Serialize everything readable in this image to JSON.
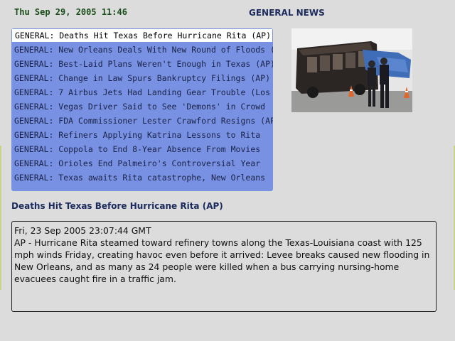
{
  "header": {
    "clock": "Thu Sep 29, 2005 11:46",
    "section_title": "GENERAL NEWS"
  },
  "headlines": {
    "selected_index": 0,
    "items": [
      {
        "label": "GENERAL: Deaths Hit Texas Before Hurricane Rita (AP)"
      },
      {
        "label": "GENERAL: New Orleans Deals With New Round of Floods (AP)"
      },
      {
        "label": "GENERAL: Best-Laid Plans Weren't Enough in Texas (AP)"
      },
      {
        "label": "GENERAL: Change in Law Spurs Bankruptcy Filings (AP)"
      },
      {
        "label": "GENERAL: 7 Airbus Jets Had Landing Gear Trouble (Los"
      },
      {
        "label": "GENERAL: Vegas Driver Said to See 'Demons' in Crowd"
      },
      {
        "label": "GENERAL: FDA Commissioner Lester Crawford Resigns (AP)"
      },
      {
        "label": "GENERAL: Refiners Applying Katrina Lessons to Rita"
      },
      {
        "label": "GENERAL: Coppola to End 8-Year Absence From Movies"
      },
      {
        "label": "GENERAL: Orioles End Palmeiro's Controversial Year"
      },
      {
        "label": "GENERAL: Texas awaits Rita catastrophe, New Orleans"
      }
    ]
  },
  "photo": {
    "icon": "news-photo-burned-bus"
  },
  "story": {
    "title": "Deaths Hit Texas Before Hurricane Rita (AP)",
    "date": "Fri, 23 Sep 2005 23:07:44 GMT",
    "body": "AP - Hurricane Rita steamed toward refinery towns along the Texas-Louisiana coast with 125 mph winds Friday, creating havoc even before it arrived: Levee breaks caused new flooding in New Orleans, and as many as 24 people were killed when a bus carrying nursing-home evacuees caught fire in a traffic jam."
  },
  "colors": {
    "background": "#dcdcdc",
    "list_panel": "#7891e2",
    "title_text": "#1c2b5e",
    "clock_text": "#1a4d1a",
    "selected_row": "#ffffff"
  }
}
